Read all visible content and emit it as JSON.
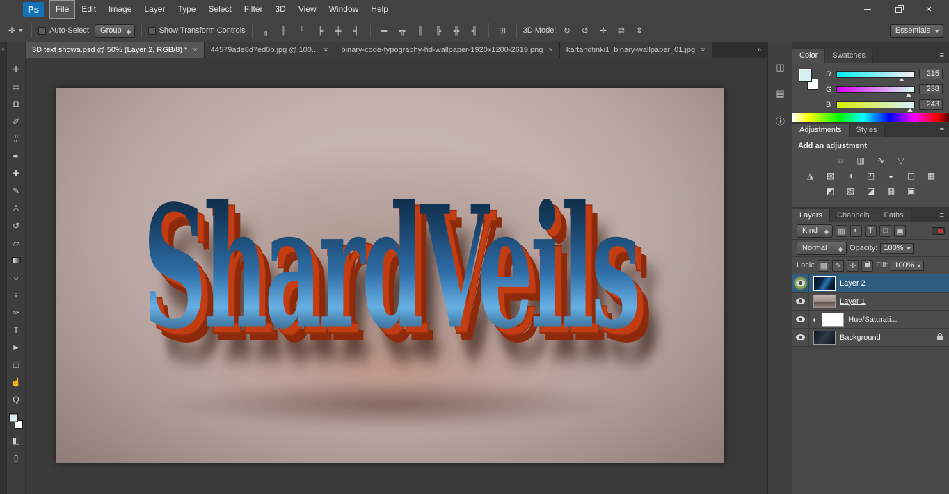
{
  "titlebar": {
    "logo": "Ps",
    "menus": [
      "File",
      "Edit",
      "Image",
      "Layer",
      "Type",
      "Select",
      "Filter",
      "3D",
      "View",
      "Window",
      "Help"
    ],
    "window_controls": [
      {
        "name": "minimize-icon"
      },
      {
        "name": "restore-icon"
      },
      {
        "name": "close-icon",
        "glyph": "×"
      }
    ]
  },
  "options_bar": {
    "tool_preset_glyph": "✛",
    "auto_select_label": "Auto-Select:",
    "auto_select_value": "Group",
    "show_transform_label": "Show Transform Controls",
    "align_icons": [
      {
        "name": "align-top-edges-icon",
        "glyph": "╥"
      },
      {
        "name": "align-vertical-centers-icon",
        "glyph": "╫"
      },
      {
        "name": "align-bottom-edges-icon",
        "glyph": "╨"
      },
      {
        "name": "align-left-edges-icon",
        "glyph": "╞"
      },
      {
        "name": "align-horizontal-centers-icon",
        "glyph": "╪"
      },
      {
        "name": "align-right-edges-icon",
        "glyph": "╡"
      }
    ],
    "distribute_icons": [
      {
        "name": "distribute-top-edges-icon",
        "glyph": "═"
      },
      {
        "name": "distribute-vertical-centers-icon",
        "glyph": "╦"
      },
      {
        "name": "distribute-bottom-edges-icon",
        "glyph": "║"
      },
      {
        "name": "distribute-left-edges-icon",
        "glyph": "╠"
      },
      {
        "name": "distribute-horizontal-centers-icon",
        "glyph": "╬"
      },
      {
        "name": "distribute-right-edges-icon",
        "glyph": "╣"
      }
    ],
    "auto_align_glyph": "⊞",
    "threed_mode_label": "3D Mode:",
    "threed_icons": [
      {
        "name": "3d-rotate-icon",
        "glyph": "↻"
      },
      {
        "name": "3d-roll-icon",
        "glyph": "↺"
      },
      {
        "name": "3d-drag-icon",
        "glyph": "✛"
      },
      {
        "name": "3d-slide-icon",
        "glyph": "⇄"
      },
      {
        "name": "3d-scale-icon",
        "glyph": "⇕"
      }
    ],
    "workspace_value": "Essentials"
  },
  "tab_bar": {
    "overflow_glyph": "»",
    "tabs": [
      {
        "label": "3D text showa.psd @ 50% (Layer 2, RGB/8) *",
        "close_glyph": "×"
      },
      {
        "label": "44579ade8d7ed0b.jpg @ 100...",
        "close_glyph": "×"
      },
      {
        "label": "binary-code-typography-hd-wallpaper-1920x1200-2619.png",
        "close_glyph": "×"
      },
      {
        "label": "kartandtinki1_binary-wallpaper_01.jpg",
        "close_glyph": "×"
      }
    ]
  },
  "toolbar": {
    "collapse_glyph": "»",
    "tools": [
      {
        "name": "move-tool",
        "glyph": "✛"
      },
      {
        "name": "rectangular-marquee-tool",
        "glyph": "▭"
      },
      {
        "name": "lasso-tool",
        "glyph": "Ω"
      },
      {
        "name": "quick-selection-tool",
        "glyph": "✐"
      },
      {
        "name": "crop-tool",
        "glyph": "#"
      },
      {
        "name": "eyedropper-tool",
        "glyph": "✒"
      },
      {
        "name": "spot-healing-brush-tool",
        "glyph": "✚"
      },
      {
        "name": "brush-tool",
        "glyph": "✎"
      },
      {
        "name": "clone-stamp-tool",
        "glyph": "♙"
      },
      {
        "name": "history-brush-tool",
        "glyph": "↺"
      },
      {
        "name": "eraser-tool",
        "glyph": "▱"
      },
      {
        "name": "gradient-tool",
        "glyph": ""
      },
      {
        "name": "blur-tool",
        "glyph": "○"
      },
      {
        "name": "dodge-tool",
        "glyph": "♀"
      },
      {
        "name": "pen-tool",
        "glyph": "✑"
      },
      {
        "name": "horizontal-type-tool",
        "glyph": "T"
      },
      {
        "name": "path-selection-tool",
        "glyph": "►"
      },
      {
        "name": "rectangle-tool",
        "glyph": "□"
      },
      {
        "name": "hand-tool",
        "glyph": "☝"
      },
      {
        "name": "zoom-tool",
        "glyph": "Q"
      }
    ],
    "foreground_color": "#d7eef3",
    "background_color": "#ffffff",
    "quick_mask_glyph": "◧",
    "screen_mode_glyph": "▯"
  },
  "canvas": {
    "artwork_text": "ShardVeils"
  },
  "minidock": {
    "icons": [
      {
        "name": "properties-panel-icon",
        "glyph": "◫"
      },
      {
        "name": "histogram-panel-icon",
        "glyph": "▤"
      },
      {
        "name": "info-panel-icon",
        "glyph": "ⓘ"
      }
    ]
  },
  "color_panel": {
    "tabs": [
      "Color",
      "Swatches"
    ],
    "panel_menu_glyph": "≡",
    "channels": [
      {
        "label": "R",
        "value": "215"
      },
      {
        "label": "G",
        "value": "238"
      },
      {
        "label": "B",
        "value": "243"
      }
    ]
  },
  "adjustments_panel": {
    "tabs": [
      "Adjustments",
      "Styles"
    ],
    "heading": "Add an adjustment",
    "row1": [
      {
        "name": "brightness-contrast-icon",
        "glyph": "☼"
      },
      {
        "name": "levels-icon",
        "glyph": "▥"
      },
      {
        "name": "curves-icon",
        "glyph": "∿"
      },
      {
        "name": "exposure-icon",
        "glyph": "▽"
      }
    ],
    "row2": [
      {
        "name": "vibrance-icon",
        "glyph": "◮"
      },
      {
        "name": "hue-saturation-icon",
        "glyph": "▧"
      },
      {
        "name": "color-balance-icon",
        "glyph": "◑"
      },
      {
        "name": "black-white-icon",
        "glyph": "◰"
      },
      {
        "name": "photo-filter-icon",
        "glyph": "◒"
      },
      {
        "name": "channel-mixer-icon",
        "glyph": "◫"
      },
      {
        "name": "color-lookup-icon",
        "glyph": "▦"
      }
    ],
    "row3": [
      {
        "name": "invert-icon",
        "glyph": "◩"
      },
      {
        "name": "posterize-icon",
        "glyph": "▨"
      },
      {
        "name": "threshold-icon",
        "glyph": "◪"
      },
      {
        "name": "gradient-map-icon",
        "glyph": "▩"
      },
      {
        "name": "selective-color-icon",
        "glyph": "▣"
      }
    ]
  },
  "layers_panel": {
    "tabs": [
      "Layers",
      "Channels",
      "Paths"
    ],
    "panel_menu_glyph": "≡",
    "filter_label": "Kind",
    "filter_icons": [
      {
        "name": "filter-pixel-layers-icon",
        "glyph": "▦"
      },
      {
        "name": "filter-adjustment-layers-icon",
        "glyph": "◐"
      },
      {
        "name": "filter-type-layers-icon",
        "glyph": "T"
      },
      {
        "name": "filter-shape-layers-icon",
        "glyph": "□"
      },
      {
        "name": "filter-smart-objects-icon",
        "glyph": "▣"
      }
    ],
    "blend_mode": "Normal",
    "opacity_label": "Opacity:",
    "opacity_value": "100%",
    "lock_label": "Lock:",
    "lock_icons": [
      {
        "name": "lock-transparent-pixels-icon",
        "glyph": "▦"
      },
      {
        "name": "lock-image-pixels-icon",
        "glyph": "✎"
      },
      {
        "name": "lock-position-icon",
        "glyph": "✛"
      }
    ],
    "fill_label": "Fill:",
    "fill_value": "100%",
    "adjustment_icon_glyph": "◐",
    "layers": [
      {
        "name": "Layer 2",
        "selected": true
      },
      {
        "name": "Layer 1",
        "selected": false
      },
      {
        "name": "Hue/Saturati...",
        "selected": false
      },
      {
        "name": "Background",
        "selected": false
      }
    ]
  },
  "colors": {
    "selected_layer_row": "#2e5d80",
    "eye_highlight": "#dee646",
    "text_extrusion": "#c43d12",
    "foreground_swatch": "#d7eef3",
    "logo_blue": "#1473b7"
  }
}
